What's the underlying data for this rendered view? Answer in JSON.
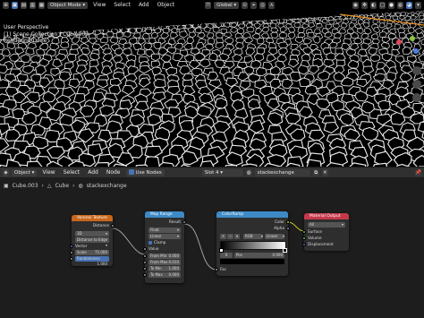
{
  "viewport": {
    "header": {
      "mode": "Object Mode",
      "menus": [
        "View",
        "Select",
        "Add",
        "Object"
      ],
      "orientation": "Global"
    },
    "overlay": {
      "line1": "User Perspective",
      "line2": "(1) Scene Collection | Cube.003",
      "line3": "Rendering Done"
    }
  },
  "node_editor": {
    "header": {
      "type": "Object",
      "menus": [
        "View",
        "Select",
        "Add",
        "Node"
      ],
      "use_nodes": "Use Nodes",
      "slot": "Slot 4",
      "material": "stackexchange"
    },
    "breadcrumb": [
      "Cube.003",
      "Cube",
      "stackexchange"
    ],
    "nodes": {
      "voronoi": {
        "title": "Voronoi Texture",
        "out_distance": "Distance",
        "dimension": "3D",
        "feature": "Distance to Edge",
        "in_vector": "Vector",
        "scale_label": "Scale",
        "scale_value": "75.000",
        "randomness_label": "Randomness",
        "randomness_value": "1.000"
      },
      "map_range": {
        "title": "Map Range",
        "out_result": "Result",
        "data_type": "Float",
        "interpolation": "Linear",
        "clamp": "Clamp",
        "in_value": "Value",
        "from_min_label": "From Min",
        "from_min_value": "0.000",
        "from_max_label": "From Max",
        "from_max_value": "0.010",
        "to_min_label": "To Min",
        "to_min_value": "1.000",
        "to_max_label": "To Max",
        "to_max_value": "0.000"
      },
      "colorramp": {
        "title": "ColorRamp",
        "out_color": "Color",
        "out_alpha": "Alpha",
        "color_mode": "RGB",
        "interp": "Linear",
        "pos_label": "Pos",
        "pos_value": "0.000",
        "index": "0",
        "in_fac": "Fac"
      },
      "material_output": {
        "title": "Material Output",
        "target": "All",
        "in_surface": "Surface",
        "in_volume": "Volume",
        "in_displacement": "Displacement"
      }
    }
  },
  "colors": {
    "texture_header": "#c8671b",
    "converter_header": "#3d8ac7",
    "output_header": "#c4394a",
    "accent": "#4772b3"
  }
}
